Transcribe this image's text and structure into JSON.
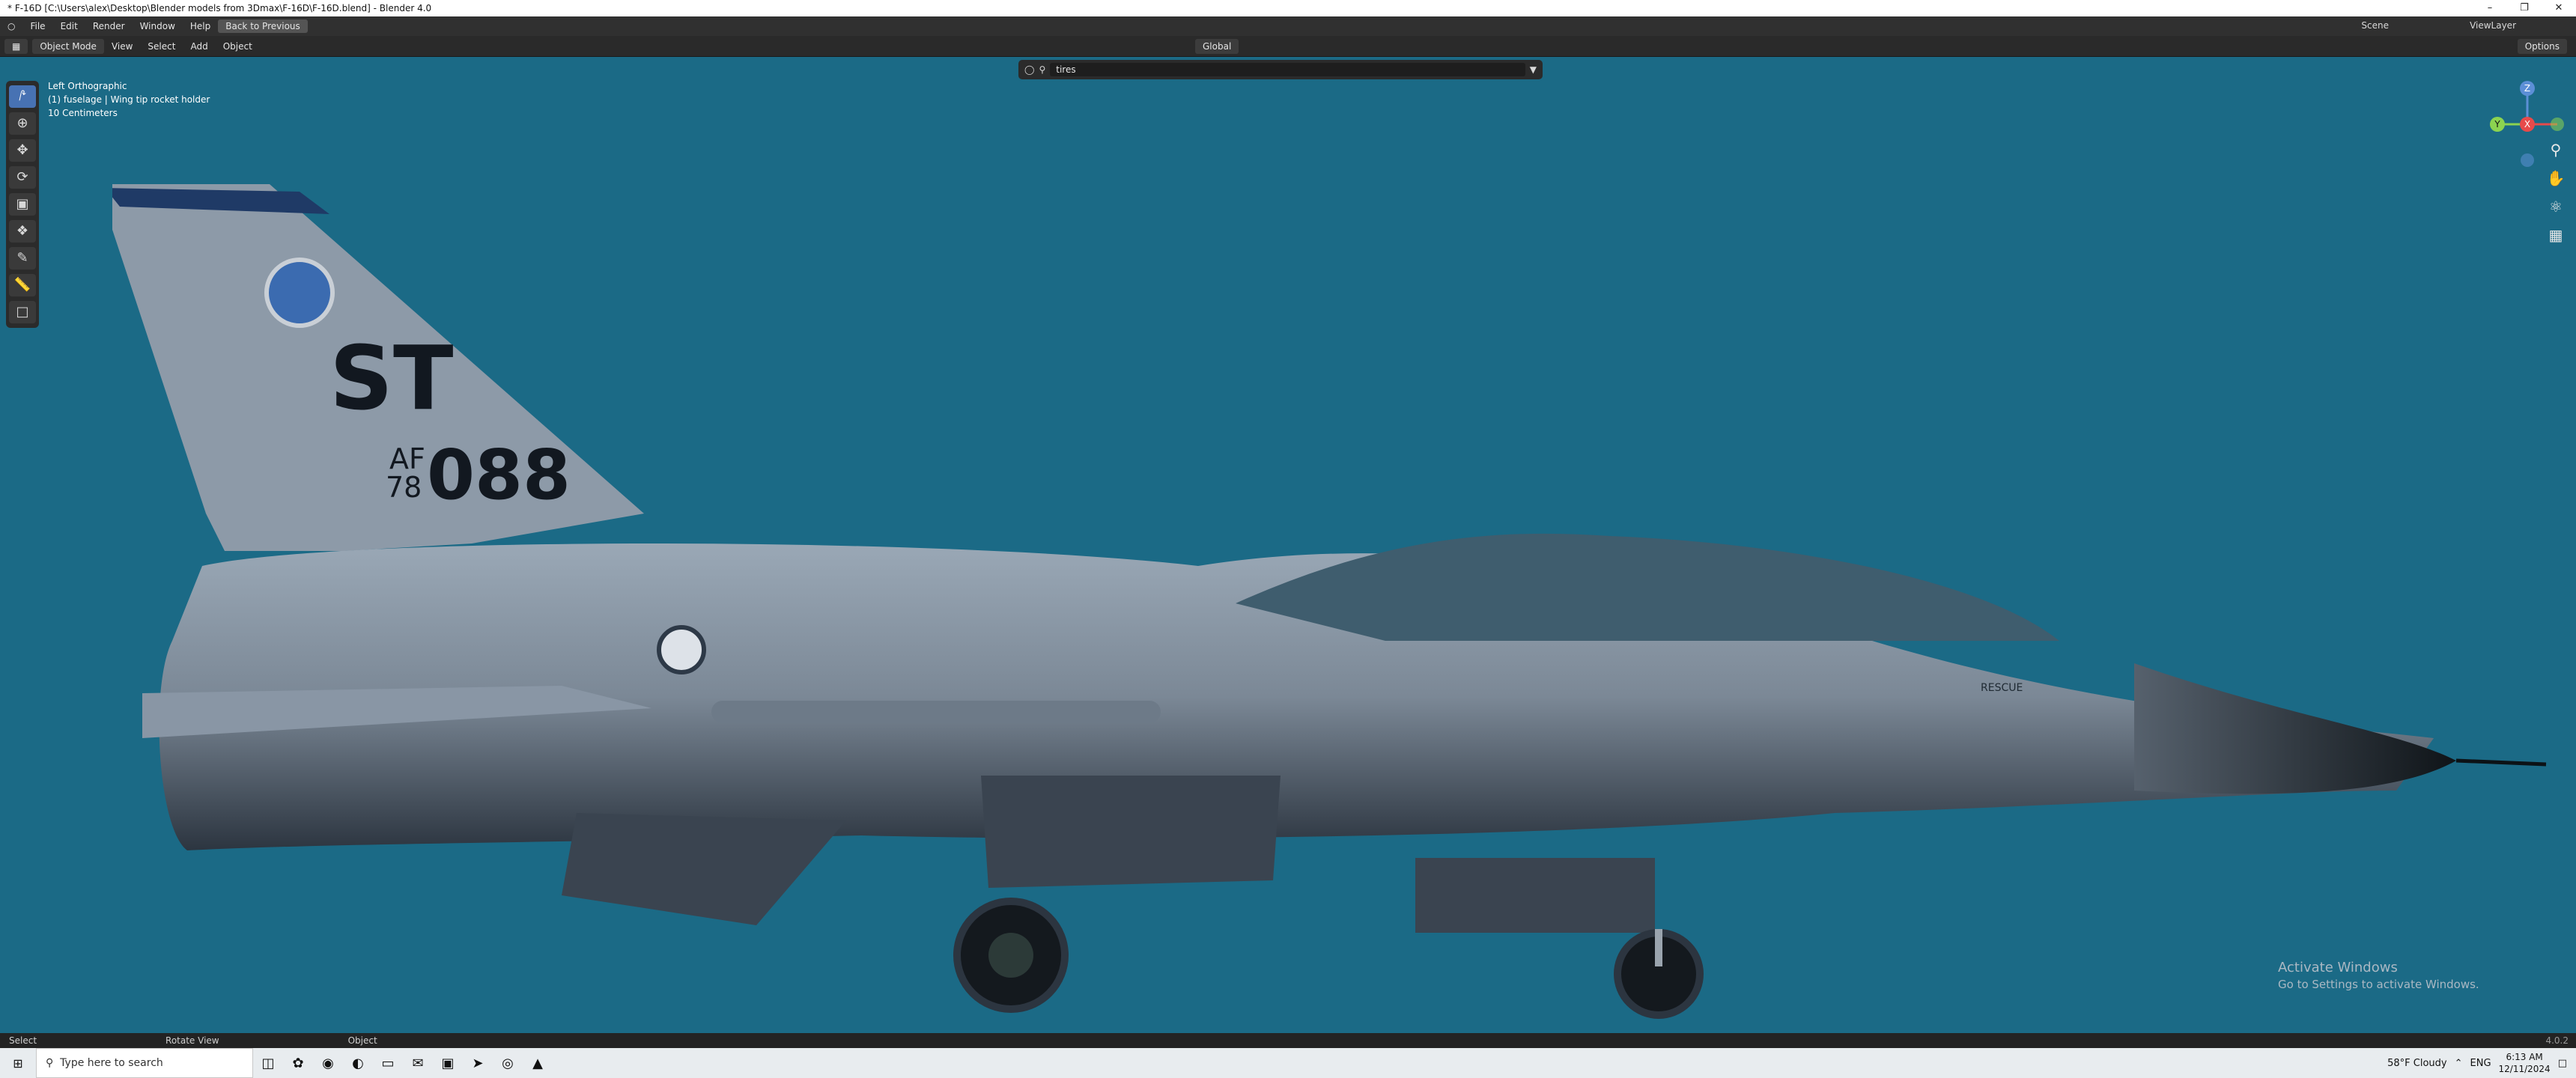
{
  "titlebar": {
    "title": "* F-16D [C:\\Users\\alex\\Desktop\\Blender models from 3Dmax\\F-16D\\F-16D.blend] - Blender 4.0"
  },
  "menubar": {
    "items": [
      "File",
      "Edit",
      "Render",
      "Window",
      "Help"
    ],
    "back_button": "Back to Previous"
  },
  "header": {
    "mode": "Object Mode",
    "menus": [
      "View",
      "Select",
      "Add",
      "Object"
    ],
    "orientation": "Global",
    "scene": "Scene",
    "view_layer": "ViewLayer",
    "options": "Options"
  },
  "viewport_header": {
    "search_value": "tires"
  },
  "overlay": {
    "view": "Left Orthographic",
    "object": "(1) fuselage | Wing tip rocket holder",
    "scale": "10 Centimeters"
  },
  "gizmo": {
    "z": "Z",
    "y": "Y",
    "x": "X"
  },
  "aircraft": {
    "unit": "ST",
    "af": "AF",
    "year": "78",
    "serial": "088",
    "placard": "RESCUE"
  },
  "watermark": {
    "title": "Activate Windows",
    "subtitle": "Go to Settings to activate Windows."
  },
  "status": {
    "select": "Select",
    "rotate": "Rotate View",
    "object": "Object",
    "version": "4.0.2"
  },
  "taskbar": {
    "search_placeholder": "Type here to search",
    "weather": "58°F  Cloudy",
    "lang": "ENG",
    "time": "6:13 AM",
    "date": "12/11/2024"
  },
  "colors": {
    "viewport_bg": "#1b6a86",
    "accent": "#4772b3"
  }
}
